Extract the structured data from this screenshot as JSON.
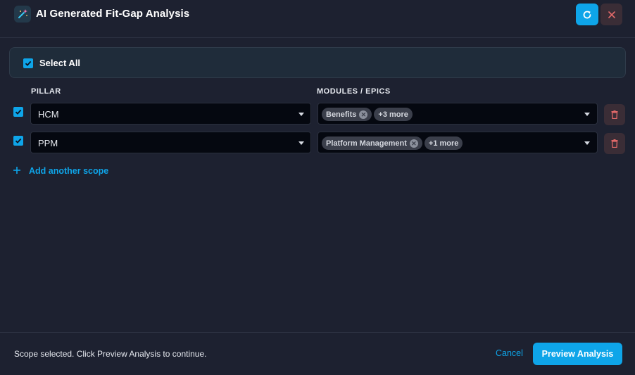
{
  "header": {
    "title": "AI Generated Fit-Gap Analysis",
    "icons": {
      "logo": "magic-wand-icon",
      "refresh": "refresh-icon",
      "close": "close-icon"
    }
  },
  "select_all": {
    "label": "Select All",
    "checked": true
  },
  "columns": {
    "pillar": "PILLAR",
    "modules": "MODULES / EPICS"
  },
  "scopes": [
    {
      "checked": true,
      "pillar": "HCM",
      "chip": "Benefits",
      "more": "+3 more"
    },
    {
      "checked": true,
      "pillar": "PPM",
      "chip": "Platform Management",
      "more": "+1 more"
    }
  ],
  "add_scope": {
    "label": "Add another scope"
  },
  "footer": {
    "status": "Scope selected. Click Preview Analysis to continue.",
    "cancel": "Cancel",
    "preview": "Preview Analysis"
  },
  "colors": {
    "background": "#1d2130",
    "accent": "#0ea5e9",
    "danger_bg": "#3a2d36",
    "danger_icon": "#e36a6a"
  }
}
